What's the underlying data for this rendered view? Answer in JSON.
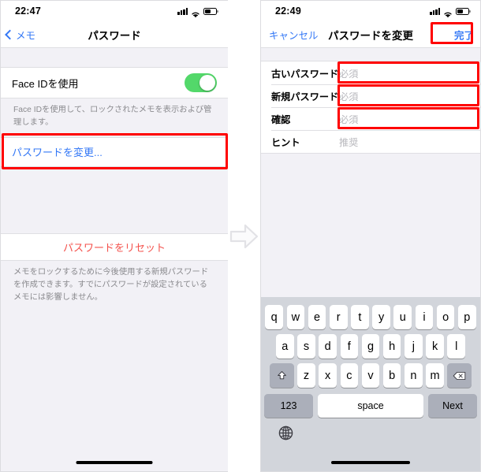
{
  "left_phone": {
    "status": {
      "time": "22:47",
      "signal_icon": "cellular-bars-icon",
      "wifi_icon": "wifi-icon",
      "battery_icon": "battery-icon"
    },
    "nav": {
      "back_label": "メモ",
      "back_icon": "chevron-left-icon",
      "title": "パスワード"
    },
    "faceid": {
      "label": "Face IDを使用",
      "toggle_state": "on",
      "toggle_color": "#53d86a"
    },
    "faceid_footnote": "Face IDを使用して、ロックされたメモを表示および管理します。",
    "change_password": {
      "label": "パスワードを変更...",
      "link_color": "#3478f6",
      "highlighted": true
    },
    "reset_password": {
      "label": "パスワードをリセット",
      "text_color": "#f4524d"
    },
    "reset_footnote": "メモをロックするために今後使用する新規パスワードを作成できます。すでにパスワードが設定されているメモには影響しません。"
  },
  "arrow": {
    "icon": "arrow-right-icon",
    "color": "#e0e0e4"
  },
  "right_phone": {
    "status": {
      "time": "22:49",
      "signal_icon": "cellular-bars-icon",
      "wifi_icon": "wifi-icon",
      "battery_icon": "battery-icon"
    },
    "nav": {
      "cancel_label": "キャンセル",
      "title": "パスワードを変更",
      "done_label": "完了",
      "done_highlighted": true
    },
    "form_rows": [
      {
        "label": "古いパスワード",
        "placeholder": "必須",
        "highlighted": true
      },
      {
        "label": "新規パスワード",
        "placeholder": "必須",
        "highlighted": true
      },
      {
        "label": "確認",
        "placeholder": "必須",
        "highlighted": true
      },
      {
        "label": "ヒント",
        "placeholder": "推奨",
        "highlighted": false
      }
    ],
    "keyboard": {
      "row1": [
        "q",
        "w",
        "e",
        "r",
        "t",
        "y",
        "u",
        "i",
        "o",
        "p"
      ],
      "row2": [
        "a",
        "s",
        "d",
        "f",
        "g",
        "h",
        "j",
        "k",
        "l"
      ],
      "row3_letters": [
        "z",
        "x",
        "c",
        "v",
        "b",
        "n",
        "m"
      ],
      "shift_icon": "shift-up-arrow-icon",
      "delete_icon": "backspace-delete-icon",
      "numeric_label": "123",
      "space_label": "space",
      "return_label": "Next",
      "globe_icon": "globe-language-icon"
    }
  },
  "highlight_color": "#ff0000"
}
